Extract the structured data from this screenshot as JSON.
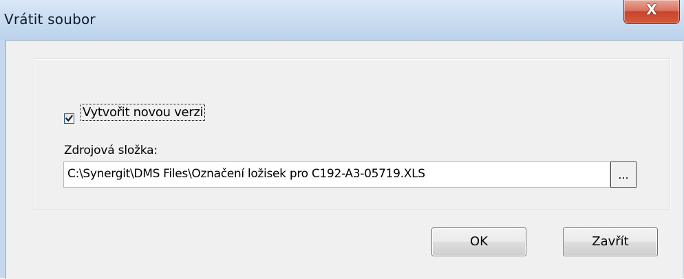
{
  "window": {
    "title": "Vrátit soubor",
    "close_glyph": "X"
  },
  "form": {
    "new_version_checkbox": {
      "label": "Vytvořit novou verzi",
      "checked": true
    },
    "source_folder": {
      "label": "Zdrojová složka:",
      "value": "C:\\Synergit\\DMS Files\\Označení ložisek pro C192-A3-05719.XLS"
    },
    "browse_label": "..."
  },
  "buttons": {
    "ok_label": "OK",
    "close_label": "Zavřít"
  },
  "icons": {
    "close": "close-icon",
    "check": "checkmark-icon"
  },
  "colors": {
    "titlebar": "#c8dbf0",
    "close_button": "#c8452c",
    "dialog_background": "#f0f0f0"
  }
}
